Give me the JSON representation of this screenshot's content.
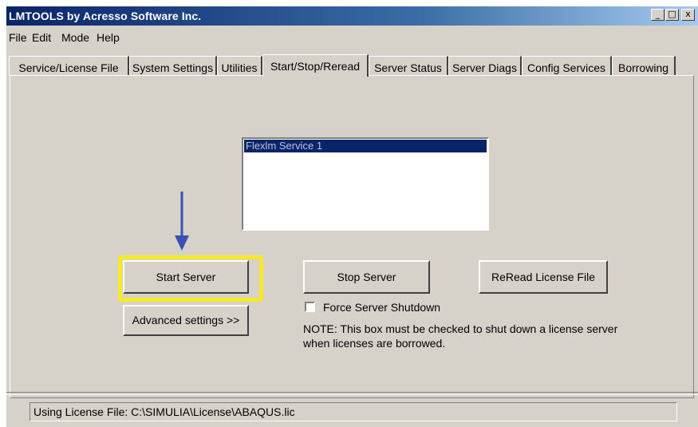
{
  "window": {
    "title": "LMTOOLS by Acresso Software Inc.",
    "controls": {
      "minimize": "_",
      "maximize": "□",
      "close": "x"
    }
  },
  "menu": [
    "File",
    "Edit",
    "Mode",
    "Help"
  ],
  "tabs": [
    {
      "label": "Service/License File"
    },
    {
      "label": "System Settings"
    },
    {
      "label": "Utilities"
    },
    {
      "label": "Start/Stop/Reread"
    },
    {
      "label": "Server Status"
    },
    {
      "label": "Server Diags"
    },
    {
      "label": "Config Services"
    },
    {
      "label": "Borrowing"
    }
  ],
  "active_tab": "Start/Stop/Reread",
  "services_list": {
    "items": [
      "Flexlm Service 1"
    ],
    "selected": "Flexlm Service 1"
  },
  "buttons": {
    "start": "Start Server",
    "stop": "Stop Server",
    "reread": "ReRead License File",
    "advanced": "Advanced settings >>"
  },
  "force_shutdown": {
    "label": "Force Server Shutdown",
    "checked": false
  },
  "note": {
    "line1": "NOTE:  This box must be checked to shut down a license server",
    "line2": "when licenses are borrowed."
  },
  "status": "Using License File:  C:\\SIMULIA\\License\\ABAQUS.lic",
  "colors": {
    "highlight": "#f5e92a",
    "arrow": "#3b4fb8",
    "selection": "#0a246a"
  }
}
